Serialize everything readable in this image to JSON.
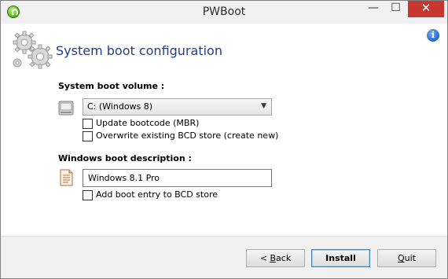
{
  "window": {
    "title": "PWBoot",
    "controls": {
      "minimize": "—",
      "maximize": "☐",
      "close": "✕"
    }
  },
  "header": {
    "title": "System boot configuration",
    "icon": "gears-icon",
    "info_icon": "info-icon"
  },
  "boot_volume": {
    "label": "System boot volume :",
    "selected": "C: (Windows 8)",
    "options": {
      "update_bootcode": {
        "label": "Update bootcode (MBR)",
        "checked": false
      },
      "overwrite_bcd": {
        "label": "Overwrite existing BCD store (create new)",
        "checked": false
      }
    }
  },
  "boot_description": {
    "label": "Windows boot description :",
    "value": "Windows 8.1 Pro",
    "add_entry": {
      "label": "Add boot entry to BCD store",
      "checked": false
    }
  },
  "buttons": {
    "back": {
      "prefix": "< ",
      "mnemonic": "B",
      "rest": "ack"
    },
    "install": {
      "label": "Install"
    },
    "quit": {
      "mnemonic": "Q",
      "rest": "uit"
    }
  },
  "colors": {
    "title_text": "#1e3e8c",
    "close_button": "#c7372f",
    "focus_border": "#3b86d8"
  }
}
